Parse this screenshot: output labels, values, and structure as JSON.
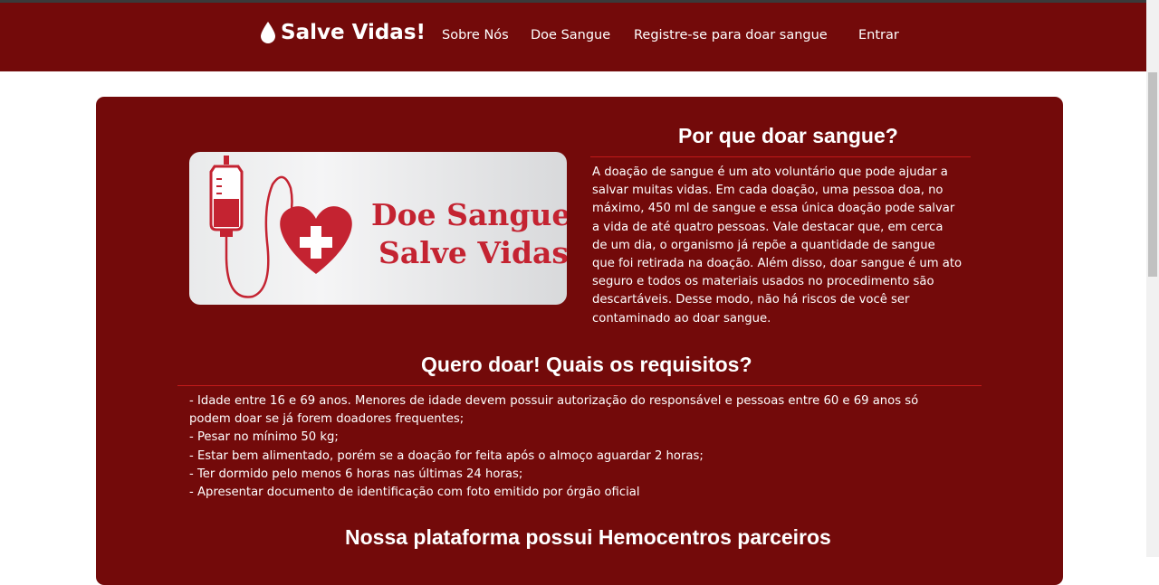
{
  "navbar": {
    "brand": "Salve Vidas!",
    "links": [
      "Sobre Nós",
      "Doe Sangue",
      "Registre-se para doar sangue",
      "Entrar"
    ]
  },
  "hero_image": {
    "line1": "Doe Sangue",
    "line2": "Salve Vidas"
  },
  "why": {
    "title": "Por que doar sangue?",
    "lines": [
      "A doação de sangue é um ato voluntário que pode ajudar a",
      "salvar muitas vidas. Em cada doação, uma pessoa doa, no",
      "máximo, 450 ml de sangue e essa única doação pode salvar",
      "a vida de até quatro pessoas. Vale destacar que, em cerca",
      "de um dia, o organismo já repõe a quantidade de sangue",
      "que foi retirada na doação. Além disso, doar sangue é um ato",
      "seguro e todos os materiais usados no procedimento são",
      "descartáveis. Desse modo, não há riscos de você ser",
      "contaminado ao doar sangue."
    ]
  },
  "requirements": {
    "title": "Quero doar! Quais os requisitos?",
    "lines": [
      "- Idade entre 16 e 69 anos. Menores de idade devem possuir autorização do responsável e pessoas entre 60 e 69 anos só",
      "podem doar se já forem doadores frequentes;",
      "- Pesar no mínimo 50 kg;",
      "- Estar bem alimentado, porém se a doação for feita após o almoço aguardar 2 horas;",
      "- Ter dormido pelo menos 6 horas nas últimas 24 horas;",
      "- Apresentar documento de identificação com foto emitido por órgão oficial"
    ]
  },
  "partners": {
    "title": "Nossa plataforma possui Hemocentros parceiros"
  },
  "colors": {
    "primary": "#730a0a",
    "accent_line": "#c11a1a",
    "image_text": "#c42331"
  },
  "icons": [
    "blood-drop-icon"
  ]
}
